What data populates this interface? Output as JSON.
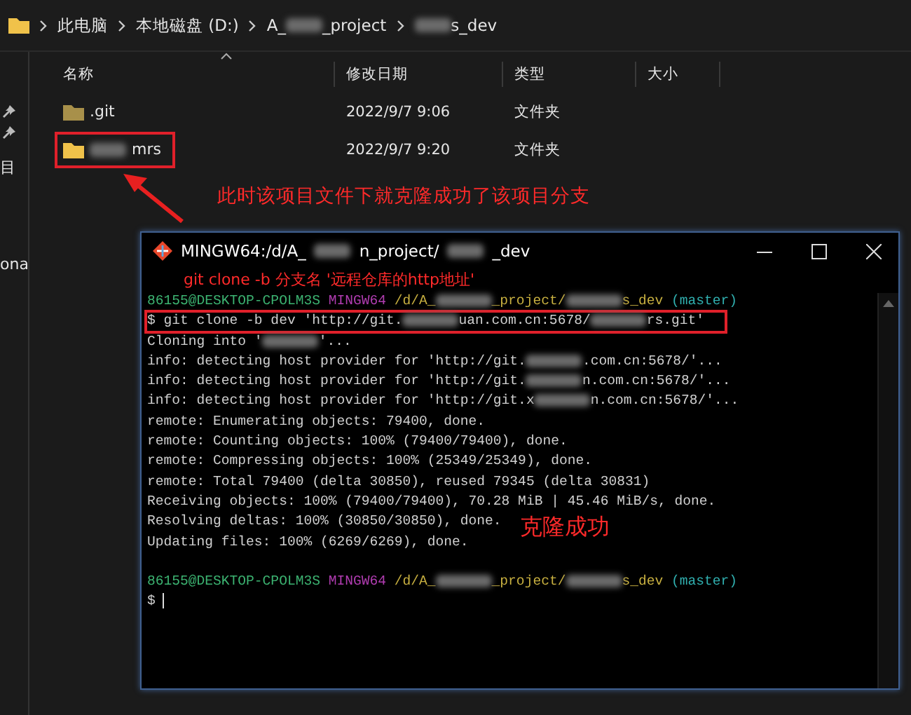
{
  "breadcrumb": [
    {
      "parts": [
        {
          "kind": "text",
          "text": "此电脑"
        }
      ]
    },
    {
      "parts": [
        {
          "kind": "text",
          "text": "本地磁盘 (D:)"
        }
      ]
    },
    {
      "parts": [
        {
          "kind": "text",
          "text": "A_"
        },
        {
          "kind": "blur"
        },
        {
          "kind": "text",
          "text": "_project"
        }
      ]
    },
    {
      "parts": [
        {
          "kind": "blur"
        },
        {
          "kind": "text",
          "text": "s_dev"
        }
      ]
    }
  ],
  "sidebar": {
    "items": [
      {
        "label": "目",
        "selected": false
      },
      {
        "label": "ona",
        "selected": false
      }
    ]
  },
  "columns": [
    "名称",
    "修改日期",
    "类型",
    "大小"
  ],
  "rows": [
    {
      "name": [
        {
          "kind": "text",
          "text": ".git"
        }
      ],
      "date": "2022/9/7 9:06",
      "type": "文件夹",
      "boxed": false,
      "color": "#a8904a"
    },
    {
      "name": [
        {
          "kind": "blur"
        },
        {
          "kind": "text",
          "text": "mrs"
        }
      ],
      "date": "2022/9/7 9:20",
      "type": "文件夹",
      "boxed": true,
      "color": "#f0c24a"
    }
  ],
  "explorer_note": "此时该项目文件下就克隆成功了该项目分支",
  "terminal": {
    "title": [
      {
        "kind": "text",
        "text": "MINGW64:/d/A_"
      },
      {
        "kind": "blur"
      },
      {
        "kind": "text",
        "text": "n_project/"
      },
      {
        "kind": "blur"
      },
      {
        "kind": "text",
        "text": "_dev"
      }
    ],
    "hint": "git clone -b 分支名 '远程仓库的http地址'",
    "lines": [
      {
        "boxed": false,
        "segments": [
          {
            "kind": "text",
            "text": "86155@DESKTOP-CPOLM3S",
            "color": "#3cb371"
          },
          {
            "kind": "text",
            "text": " MINGW64",
            "color": "#b03cb0"
          },
          {
            "kind": "text",
            "text": " /d/A_",
            "color": "#c8b040"
          },
          {
            "kind": "blur"
          },
          {
            "kind": "text",
            "text": "_project/",
            "color": "#c8b040"
          },
          {
            "kind": "blur"
          },
          {
            "kind": "text",
            "text": "s_dev",
            "color": "#c8b040"
          },
          {
            "kind": "text",
            "text": " (master)",
            "color": "#30b0b0"
          }
        ]
      },
      {
        "boxed": true,
        "segments": [
          {
            "kind": "text",
            "text": "$ git clone -b dev 'http://git."
          },
          {
            "kind": "blur"
          },
          {
            "kind": "text",
            "text": "uan.com.cn:5678/"
          },
          {
            "kind": "blur"
          },
          {
            "kind": "text",
            "text": "rs.git'"
          }
        ]
      },
      {
        "boxed": false,
        "segments": [
          {
            "kind": "text",
            "text": "Cloning into '",
            "color": "#d0d0d0"
          },
          {
            "kind": "blur"
          },
          {
            "kind": "text",
            "text": "'...",
            "color": "#d0d0d0"
          }
        ]
      },
      {
        "boxed": false,
        "segments": [
          {
            "kind": "text",
            "text": "info: detecting host provider for 'http://git.",
            "color": "#d0d0d0"
          },
          {
            "kind": "blur"
          },
          {
            "kind": "text",
            "text": ".com.cn:5678/'...",
            "color": "#d0d0d0"
          }
        ]
      },
      {
        "boxed": false,
        "segments": [
          {
            "kind": "text",
            "text": "info: detecting host provider for 'http://git.",
            "color": "#d0d0d0"
          },
          {
            "kind": "blur"
          },
          {
            "kind": "text",
            "text": "n.com.cn:5678/'...",
            "color": "#d0d0d0"
          }
        ]
      },
      {
        "boxed": false,
        "segments": [
          {
            "kind": "text",
            "text": "info: detecting host provider for 'http://git.x",
            "color": "#d0d0d0"
          },
          {
            "kind": "blur"
          },
          {
            "kind": "text",
            "text": "n.com.cn:5678/'...",
            "color": "#d0d0d0"
          }
        ]
      },
      {
        "boxed": false,
        "segments": [
          {
            "kind": "text",
            "text": "remote: Enumerating objects: 79400, done.",
            "color": "#d0d0d0"
          }
        ]
      },
      {
        "boxed": false,
        "segments": [
          {
            "kind": "text",
            "text": "remote: Counting objects: 100% (79400/79400), done.",
            "color": "#d0d0d0"
          }
        ]
      },
      {
        "boxed": false,
        "segments": [
          {
            "kind": "text",
            "text": "remote: Compressing objects: 100% (25349/25349), done.",
            "color": "#d0d0d0"
          }
        ]
      },
      {
        "boxed": false,
        "segments": [
          {
            "kind": "text",
            "text": "remote: Total 79400 (delta 30850), reused 79345 (delta 30831)",
            "color": "#d0d0d0"
          }
        ]
      },
      {
        "boxed": false,
        "segments": [
          {
            "kind": "text",
            "text": "Receiving objects: 100% (79400/79400), 70.28 MiB | 45.46 MiB/s, done.",
            "color": "#d0d0d0"
          }
        ]
      },
      {
        "boxed": false,
        "segments": [
          {
            "kind": "text",
            "text": "Resolving deltas: 100% (30850/30850), done.",
            "color": "#d0d0d0"
          }
        ]
      },
      {
        "boxed": false,
        "segments": [
          {
            "kind": "text",
            "text": "Updating files: 100% (6269/6269), done.",
            "color": "#d0d0d0"
          }
        ]
      },
      {
        "boxed": false
      },
      {
        "boxed": false,
        "segments": [
          {
            "kind": "text",
            "text": "86155@DESKTOP-CPOLM3S",
            "color": "#3cb371"
          },
          {
            "kind": "text",
            "text": " MINGW64",
            "color": "#b03cb0"
          },
          {
            "kind": "text",
            "text": " /d/A_",
            "color": "#c8b040"
          },
          {
            "kind": "blur"
          },
          {
            "kind": "text",
            "text": "_project/",
            "color": "#c8b040"
          },
          {
            "kind": "blur"
          },
          {
            "kind": "text",
            "text": "s_dev",
            "color": "#c8b040"
          },
          {
            "kind": "text",
            "text": " (master)",
            "color": "#30b0b0"
          }
        ]
      },
      {
        "boxed": false,
        "segments": [
          {
            "kind": "text",
            "text": "$",
            "color": "#d0d0d0"
          },
          {
            "kind": "cursor"
          }
        ]
      }
    ],
    "success_note": "克隆成功"
  }
}
